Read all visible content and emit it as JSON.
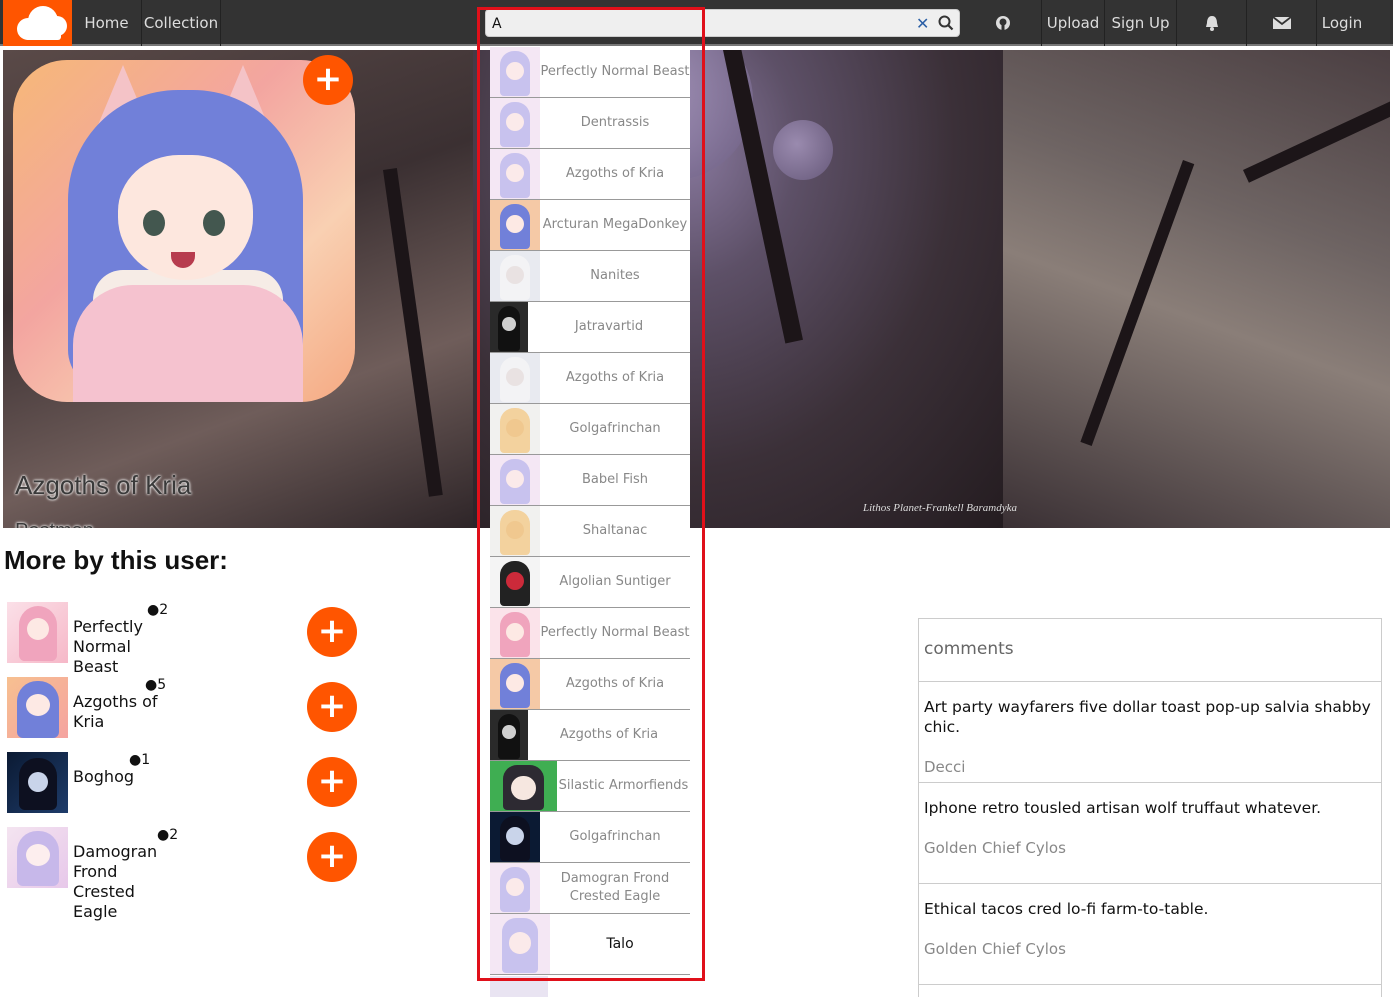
{
  "nav": {
    "logo": "cloud-logo",
    "home": "Home",
    "collection": "Collection",
    "upload": "Upload",
    "signup": "Sign Up",
    "login": "Login"
  },
  "search": {
    "value": "A",
    "placeholder": ""
  },
  "hero": {
    "title": "Azgoths of Kria",
    "subtitle": "Postman",
    "watermark": "Lithos Planet-Frankell Baramdyka"
  },
  "more": {
    "heading": "More by this user:",
    "items": [
      {
        "title": "Perfectly Normal Beast",
        "count": "2"
      },
      {
        "title": "Azgoths of Kria",
        "count": "5"
      },
      {
        "title": "Boghog",
        "count": "1"
      },
      {
        "title": "Damogran Frond Crested Eagle",
        "count": "2"
      }
    ]
  },
  "comments": {
    "heading": "comments",
    "items": [
      {
        "text": "Art party wayfarers five dollar toast pop-up salvia shabby chic.",
        "author": "Decci"
      },
      {
        "text": "Iphone retro tousled artisan wolf truffaut whatever.",
        "author": "Golden Chief Cylos"
      },
      {
        "text": "Ethical tacos cred lo-fi farm-to-table.",
        "author": "Golden Chief Cylos"
      }
    ]
  },
  "dropdown": {
    "items": [
      {
        "label": "Perfectly Normal Beast",
        "thumb": "pink"
      },
      {
        "label": "Dentrassis",
        "thumb": "pink"
      },
      {
        "label": "Azgoths of Kria",
        "thumb": "pink"
      },
      {
        "label": "Arcturan MegaDonkey",
        "thumb": "blue"
      },
      {
        "label": "Nanites",
        "thumb": "white"
      },
      {
        "label": "Jatravartid",
        "thumb": "dark"
      },
      {
        "label": "Azgoths of Kria",
        "thumb": "white"
      },
      {
        "label": "Golgafrinchan",
        "thumb": "bald"
      },
      {
        "label": "Babel Fish",
        "thumb": "pink"
      },
      {
        "label": "Shaltanac",
        "thumb": "bald"
      },
      {
        "label": "Algolian Suntiger",
        "thumb": "red"
      },
      {
        "label": "Perfectly Normal Beast",
        "thumb": "pinkhair"
      },
      {
        "label": "Azgoths of Kria",
        "thumb": "blue"
      },
      {
        "label": "Azgoths of Kria",
        "thumb": "dark"
      },
      {
        "label": "Silastic Armorfiends",
        "thumb": "green"
      },
      {
        "label": "Golgafrinchan",
        "thumb": "night"
      },
      {
        "label": "Damogran Frond Crested Eagle",
        "thumb": "pink"
      },
      {
        "label": "Talo",
        "thumb": "pink"
      }
    ]
  },
  "colors": {
    "accent": "#ff5500",
    "navbar": "#333333",
    "highlight": "#e0101a"
  }
}
